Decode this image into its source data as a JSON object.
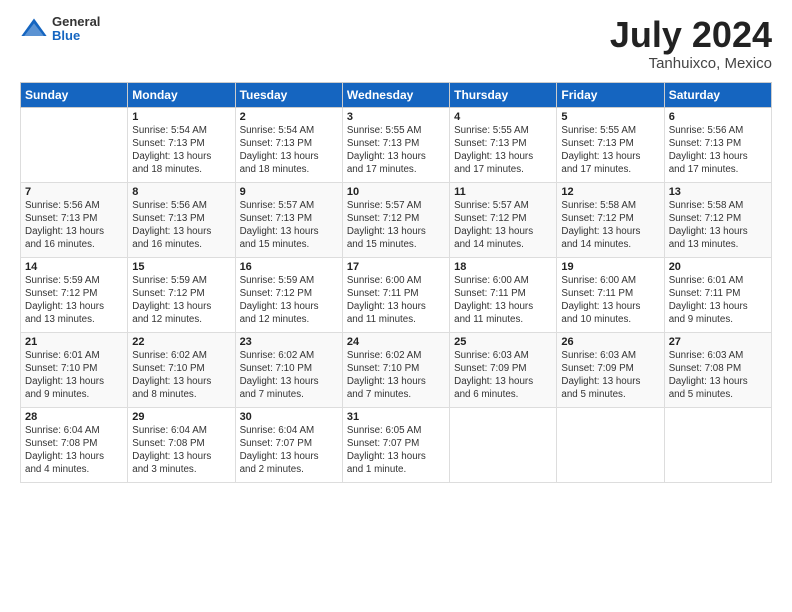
{
  "logo": {
    "general": "General",
    "blue": "Blue"
  },
  "header": {
    "month": "July 2024",
    "location": "Tanhuixco, Mexico"
  },
  "weekdays": [
    "Sunday",
    "Monday",
    "Tuesday",
    "Wednesday",
    "Thursday",
    "Friday",
    "Saturday"
  ],
  "weeks": [
    [
      {
        "day": "",
        "info": ""
      },
      {
        "day": "1",
        "info": "Sunrise: 5:54 AM\nSunset: 7:13 PM\nDaylight: 13 hours\nand 18 minutes."
      },
      {
        "day": "2",
        "info": "Sunrise: 5:54 AM\nSunset: 7:13 PM\nDaylight: 13 hours\nand 18 minutes."
      },
      {
        "day": "3",
        "info": "Sunrise: 5:55 AM\nSunset: 7:13 PM\nDaylight: 13 hours\nand 17 minutes."
      },
      {
        "day": "4",
        "info": "Sunrise: 5:55 AM\nSunset: 7:13 PM\nDaylight: 13 hours\nand 17 minutes."
      },
      {
        "day": "5",
        "info": "Sunrise: 5:55 AM\nSunset: 7:13 PM\nDaylight: 13 hours\nand 17 minutes."
      },
      {
        "day": "6",
        "info": "Sunrise: 5:56 AM\nSunset: 7:13 PM\nDaylight: 13 hours\nand 17 minutes."
      }
    ],
    [
      {
        "day": "7",
        "info": "Sunrise: 5:56 AM\nSunset: 7:13 PM\nDaylight: 13 hours\nand 16 minutes."
      },
      {
        "day": "8",
        "info": "Sunrise: 5:56 AM\nSunset: 7:13 PM\nDaylight: 13 hours\nand 16 minutes."
      },
      {
        "day": "9",
        "info": "Sunrise: 5:57 AM\nSunset: 7:13 PM\nDaylight: 13 hours\nand 15 minutes."
      },
      {
        "day": "10",
        "info": "Sunrise: 5:57 AM\nSunset: 7:12 PM\nDaylight: 13 hours\nand 15 minutes."
      },
      {
        "day": "11",
        "info": "Sunrise: 5:57 AM\nSunset: 7:12 PM\nDaylight: 13 hours\nand 14 minutes."
      },
      {
        "day": "12",
        "info": "Sunrise: 5:58 AM\nSunset: 7:12 PM\nDaylight: 13 hours\nand 14 minutes."
      },
      {
        "day": "13",
        "info": "Sunrise: 5:58 AM\nSunset: 7:12 PM\nDaylight: 13 hours\nand 13 minutes."
      }
    ],
    [
      {
        "day": "14",
        "info": "Sunrise: 5:59 AM\nSunset: 7:12 PM\nDaylight: 13 hours\nand 13 minutes."
      },
      {
        "day": "15",
        "info": "Sunrise: 5:59 AM\nSunset: 7:12 PM\nDaylight: 13 hours\nand 12 minutes."
      },
      {
        "day": "16",
        "info": "Sunrise: 5:59 AM\nSunset: 7:12 PM\nDaylight: 13 hours\nand 12 minutes."
      },
      {
        "day": "17",
        "info": "Sunrise: 6:00 AM\nSunset: 7:11 PM\nDaylight: 13 hours\nand 11 minutes."
      },
      {
        "day": "18",
        "info": "Sunrise: 6:00 AM\nSunset: 7:11 PM\nDaylight: 13 hours\nand 11 minutes."
      },
      {
        "day": "19",
        "info": "Sunrise: 6:00 AM\nSunset: 7:11 PM\nDaylight: 13 hours\nand 10 minutes."
      },
      {
        "day": "20",
        "info": "Sunrise: 6:01 AM\nSunset: 7:11 PM\nDaylight: 13 hours\nand 9 minutes."
      }
    ],
    [
      {
        "day": "21",
        "info": "Sunrise: 6:01 AM\nSunset: 7:10 PM\nDaylight: 13 hours\nand 9 minutes."
      },
      {
        "day": "22",
        "info": "Sunrise: 6:02 AM\nSunset: 7:10 PM\nDaylight: 13 hours\nand 8 minutes."
      },
      {
        "day": "23",
        "info": "Sunrise: 6:02 AM\nSunset: 7:10 PM\nDaylight: 13 hours\nand 7 minutes."
      },
      {
        "day": "24",
        "info": "Sunrise: 6:02 AM\nSunset: 7:10 PM\nDaylight: 13 hours\nand 7 minutes."
      },
      {
        "day": "25",
        "info": "Sunrise: 6:03 AM\nSunset: 7:09 PM\nDaylight: 13 hours\nand 6 minutes."
      },
      {
        "day": "26",
        "info": "Sunrise: 6:03 AM\nSunset: 7:09 PM\nDaylight: 13 hours\nand 5 minutes."
      },
      {
        "day": "27",
        "info": "Sunrise: 6:03 AM\nSunset: 7:08 PM\nDaylight: 13 hours\nand 5 minutes."
      }
    ],
    [
      {
        "day": "28",
        "info": "Sunrise: 6:04 AM\nSunset: 7:08 PM\nDaylight: 13 hours\nand 4 minutes."
      },
      {
        "day": "29",
        "info": "Sunrise: 6:04 AM\nSunset: 7:08 PM\nDaylight: 13 hours\nand 3 minutes."
      },
      {
        "day": "30",
        "info": "Sunrise: 6:04 AM\nSunset: 7:07 PM\nDaylight: 13 hours\nand 2 minutes."
      },
      {
        "day": "31",
        "info": "Sunrise: 6:05 AM\nSunset: 7:07 PM\nDaylight: 13 hours\nand 1 minute."
      },
      {
        "day": "",
        "info": ""
      },
      {
        "day": "",
        "info": ""
      },
      {
        "day": "",
        "info": ""
      }
    ]
  ]
}
